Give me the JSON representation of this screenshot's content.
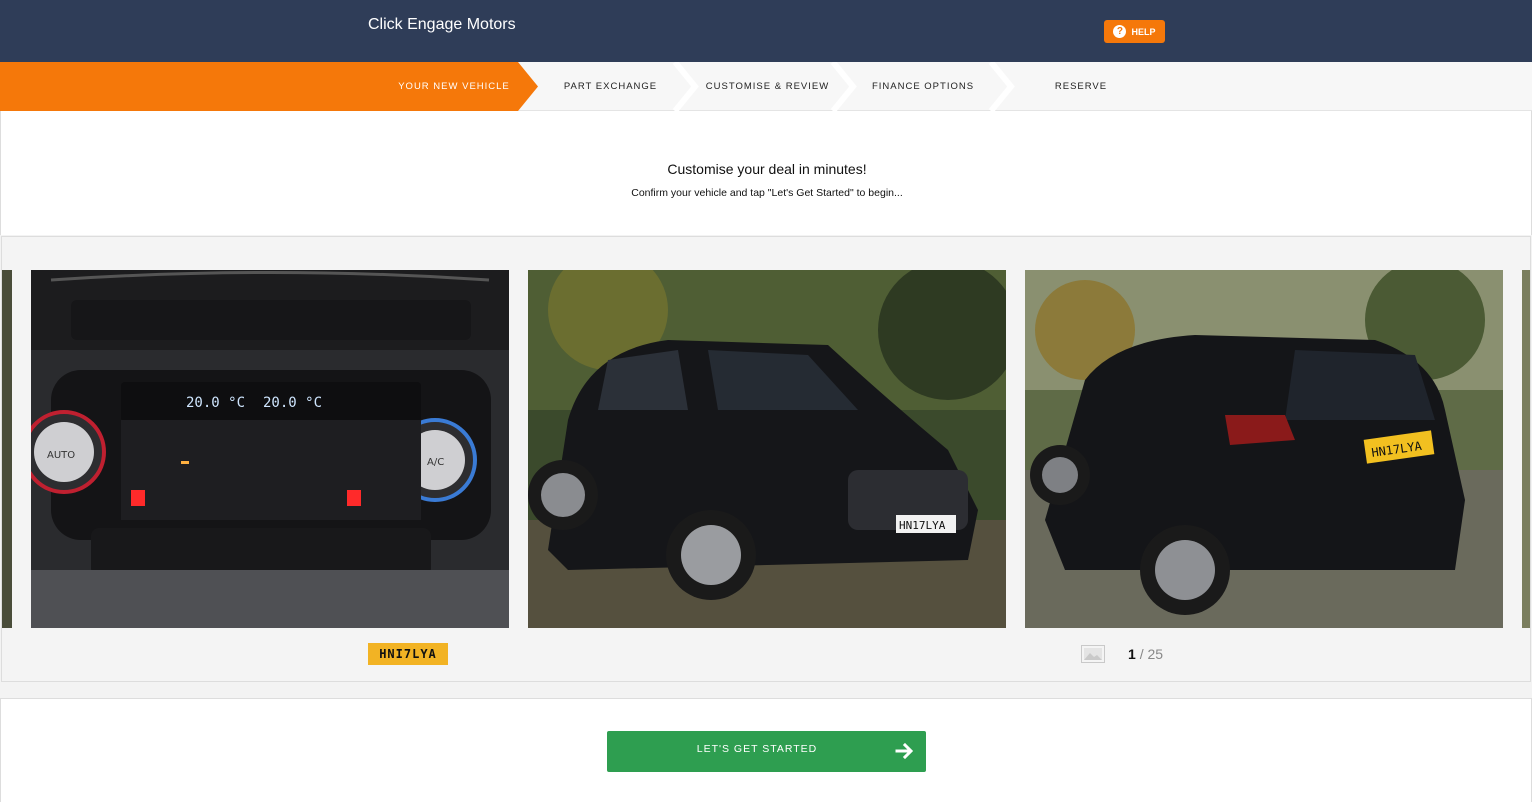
{
  "header": {
    "brand": "Click Engage Motors",
    "help_label": "HELP",
    "help_icon": "question-circle-icon"
  },
  "steps": [
    {
      "label": "YOUR NEW VEHICLE",
      "active": true
    },
    {
      "label": "PART EXCHANGE",
      "active": false
    },
    {
      "label": "CUSTOMISE & REVIEW",
      "active": false
    },
    {
      "label": "FINANCE OPTIONS",
      "active": false
    },
    {
      "label": "RESERVE",
      "active": false
    }
  ],
  "intro": {
    "title": "Customise your deal in minutes!",
    "subtitle": "Confirm your vehicle and tap \"Let's Get Started\" to begin..."
  },
  "gallery": {
    "registration": "HNI7LYA",
    "current": "1",
    "separator": "/ 25",
    "gallery_icon": "image-gallery-icon"
  },
  "cta": {
    "label": "LET'S GET STARTED",
    "icon": "arrow-right-icon"
  },
  "colors": {
    "header_bg": "#2f3d58",
    "accent": "#f5780a",
    "cta": "#2e9e50",
    "plate": "#f2b324"
  }
}
